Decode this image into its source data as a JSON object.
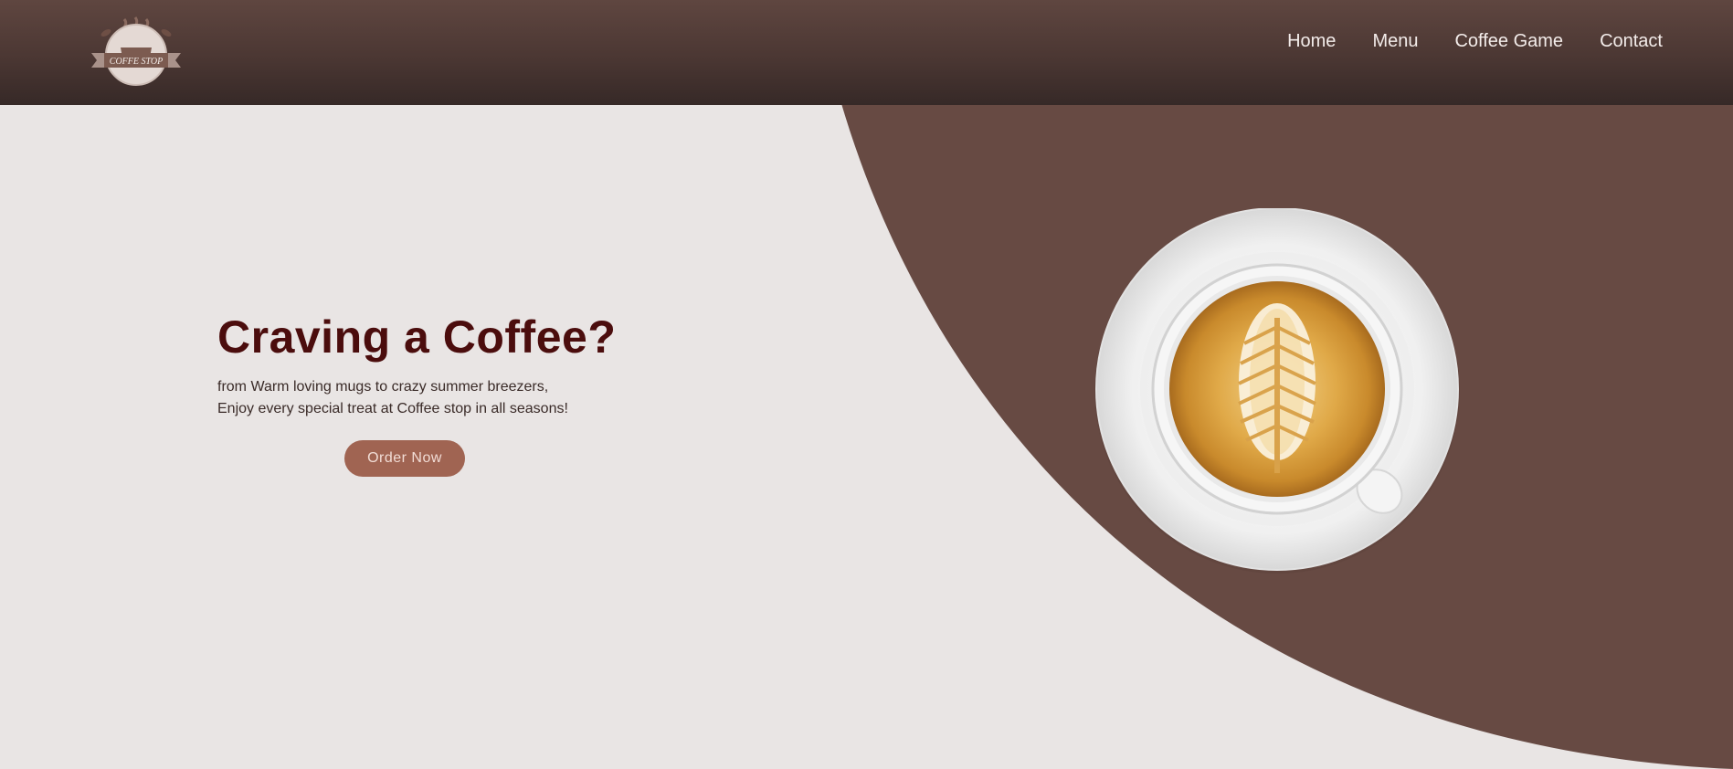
{
  "logo": {
    "text": "COFFE STOP"
  },
  "nav": {
    "items": [
      "Home",
      "Menu",
      "Coffee Game",
      "Contact"
    ]
  },
  "hero": {
    "title": "Craving a Coffee?",
    "subtitle_line1": "from Warm loving mugs to crazy summer breezers,",
    "subtitle_line2": "Enjoy every special treat at Coffee stop in all seasons!",
    "cta_label": "Order Now"
  },
  "colors": {
    "header": "#4b3733",
    "accent_brown": "#674a43",
    "background": "#e9e5e4",
    "title": "#4b0d0d",
    "button": "#a06452"
  },
  "icons": {
    "logo": "coffee-cup-logo-icon",
    "hero_image": "latte-art-cup-icon"
  }
}
